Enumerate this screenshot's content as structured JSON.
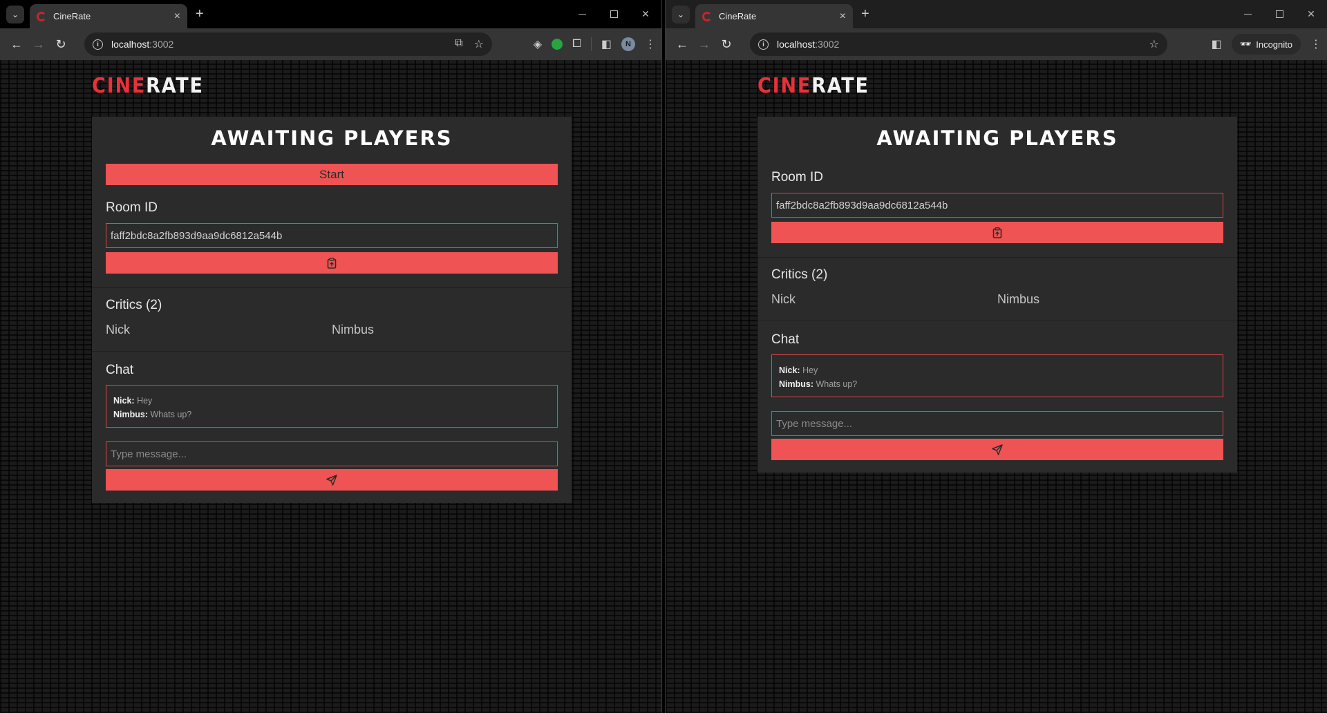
{
  "browser": {
    "tab_title": "CineRate",
    "url_host": "localhost",
    "url_port": ":3002",
    "incognito_label": "Incognito",
    "avatar_initial": "N"
  },
  "app": {
    "logo_cine": "CINE",
    "logo_rate": "RATE",
    "title": "AWAITING PLAYERS",
    "start_label": "Start",
    "room_label": "Room ID",
    "room_id": "faff2bdc8a2fb893d9aa9dc6812a544b",
    "critics_label": "Critics (2)",
    "critics": [
      "Nick",
      "Nimbus"
    ],
    "chat_label": "Chat",
    "messages": [
      {
        "name": "Nick:",
        "text": "Hey"
      },
      {
        "name": "Nimbus:",
        "text": "Whats up?"
      }
    ],
    "message_placeholder": "Type message..."
  },
  "colors": {
    "accent": "#f05353",
    "logo_red": "#e8313a",
    "card_bg": "#2b2b2b"
  },
  "icons": {
    "copy": "clipboard-icon",
    "send": "send-icon"
  }
}
